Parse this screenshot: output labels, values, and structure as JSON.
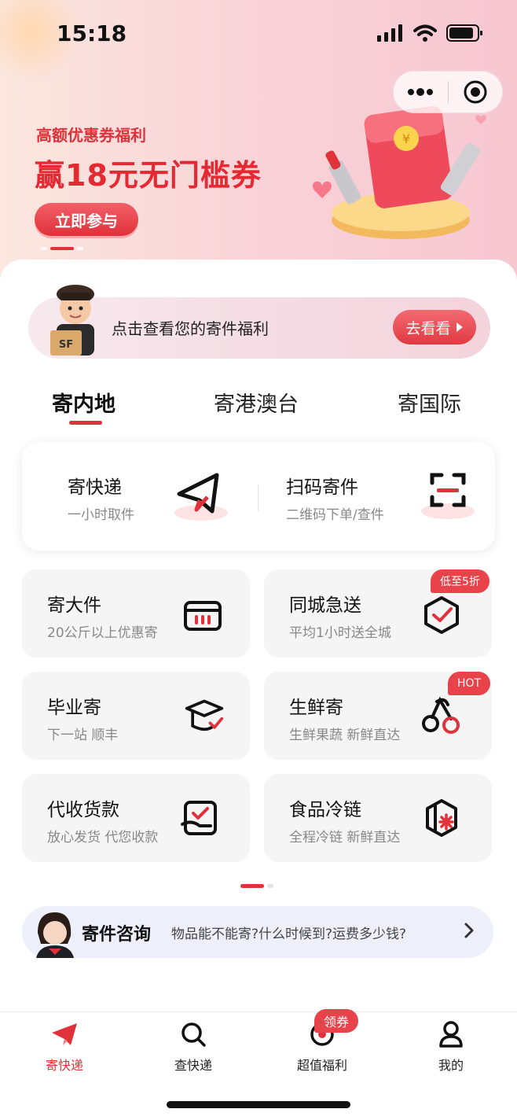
{
  "status_bar": {
    "time": "15:18"
  },
  "banner": {
    "subtitle": "高额优惠券福利",
    "title": "赢18元无门槛券",
    "button": "立即参与"
  },
  "welfare": {
    "text": "点击查看您的寄件福利",
    "button": "去看看"
  },
  "tabs": [
    "寄内地",
    "寄港澳台",
    "寄国际"
  ],
  "quick": [
    {
      "title": "寄快递",
      "sub": "一小时取件"
    },
    {
      "title": "扫码寄件",
      "sub": "二维码下单/查件"
    }
  ],
  "services": [
    {
      "title": "寄大件",
      "sub": "20公斤以上优惠寄",
      "icon": "box-icon"
    },
    {
      "title": "同城急送",
      "sub": "平均1小时送全城",
      "icon": "hex-check-icon",
      "badge": "低至5折"
    },
    {
      "title": "毕业寄",
      "sub": "下一站 顺丰",
      "icon": "graduation-cap-icon"
    },
    {
      "title": "生鲜寄",
      "sub": "生鲜果蔬 新鲜直达",
      "icon": "cherry-icon",
      "badge": "HOT"
    },
    {
      "title": "代收货款",
      "sub": "放心发货 代您收款",
      "icon": "cash-hand-icon"
    },
    {
      "title": "食品冷链",
      "sub": "全程冷链 新鲜直达",
      "icon": "snowflake-box-icon"
    }
  ],
  "consult": {
    "title": "寄件咨询",
    "sub": "物品能不能寄?什么时候到?运费多少钱?"
  },
  "tabbar": [
    {
      "label": "寄快递",
      "icon": "send-icon"
    },
    {
      "label": "查快递",
      "icon": "search-icon"
    },
    {
      "label": "超值福利",
      "icon": "coupon-icon",
      "badge": "领券"
    },
    {
      "label": "我的",
      "icon": "user-icon"
    }
  ],
  "colors": {
    "accent": "#e0323b",
    "card_bg": "#f5f5f5"
  }
}
